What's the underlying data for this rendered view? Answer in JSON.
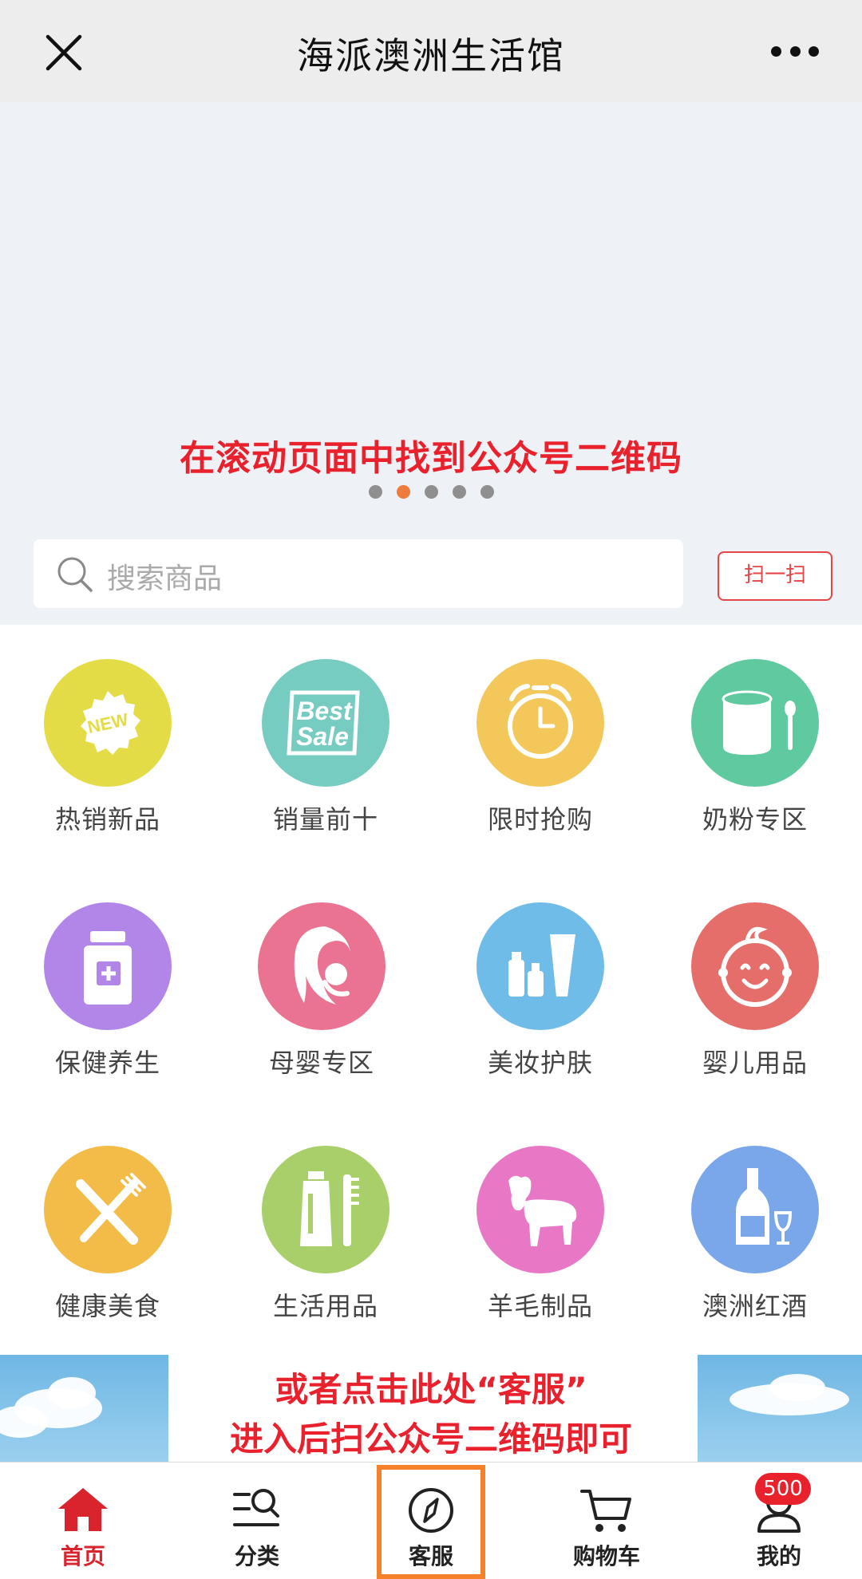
{
  "header": {
    "title": "海派澳洲生活馆",
    "close_icon": "close-icon",
    "more_icon": "more-icon"
  },
  "banner": {
    "note": "在滚动页面中找到公众号二维码",
    "dots_count": 5,
    "active_dot": 2
  },
  "search": {
    "placeholder": "搜索商品",
    "scan_label": "扫一扫"
  },
  "categories": [
    {
      "label": "热销新品",
      "icon": "new-badge-icon",
      "color": "#e3dc46"
    },
    {
      "label": "销量前十",
      "icon": "best-sale-icon",
      "color": "#77ccc1"
    },
    {
      "label": "限时抢购",
      "icon": "alarm-clock-icon",
      "color": "#f3c75a"
    },
    {
      "label": "奶粉专区",
      "icon": "milk-can-icon",
      "color": "#5fc9a0"
    },
    {
      "label": "保健养生",
      "icon": "medicine-bottle-icon",
      "color": "#b286e9"
    },
    {
      "label": "母婴专区",
      "icon": "mother-baby-icon",
      "color": "#ea7391"
    },
    {
      "label": "美妆护肤",
      "icon": "cosmetics-icon",
      "color": "#6fbce8"
    },
    {
      "label": "婴儿用品",
      "icon": "baby-face-icon",
      "color": "#e56e6b"
    },
    {
      "label": "健康美食",
      "icon": "knife-fork-icon",
      "color": "#f3bc48"
    },
    {
      "label": "生活用品",
      "icon": "toothbrush-icon",
      "color": "#a9cf6a"
    },
    {
      "label": "羊毛制品",
      "icon": "sheep-icon",
      "color": "#e878c6"
    },
    {
      "label": "澳洲红酒",
      "icon": "wine-bottle-icon",
      "color": "#7aa6ea"
    }
  ],
  "lower_banner": {
    "line1": "或者点击此处“客服”",
    "line2": "进入后扫公众号二维码即可"
  },
  "tabbar": {
    "items": [
      {
        "label": "首页",
        "icon": "home-icon"
      },
      {
        "label": "分类",
        "icon": "category-search-icon"
      },
      {
        "label": "客服",
        "icon": "compass-icon"
      },
      {
        "label": "购物车",
        "icon": "cart-icon"
      },
      {
        "label": "我的",
        "icon": "user-icon"
      }
    ],
    "badge": "500",
    "active_color": "#d9232d",
    "highlight_color": "#f5822a"
  }
}
